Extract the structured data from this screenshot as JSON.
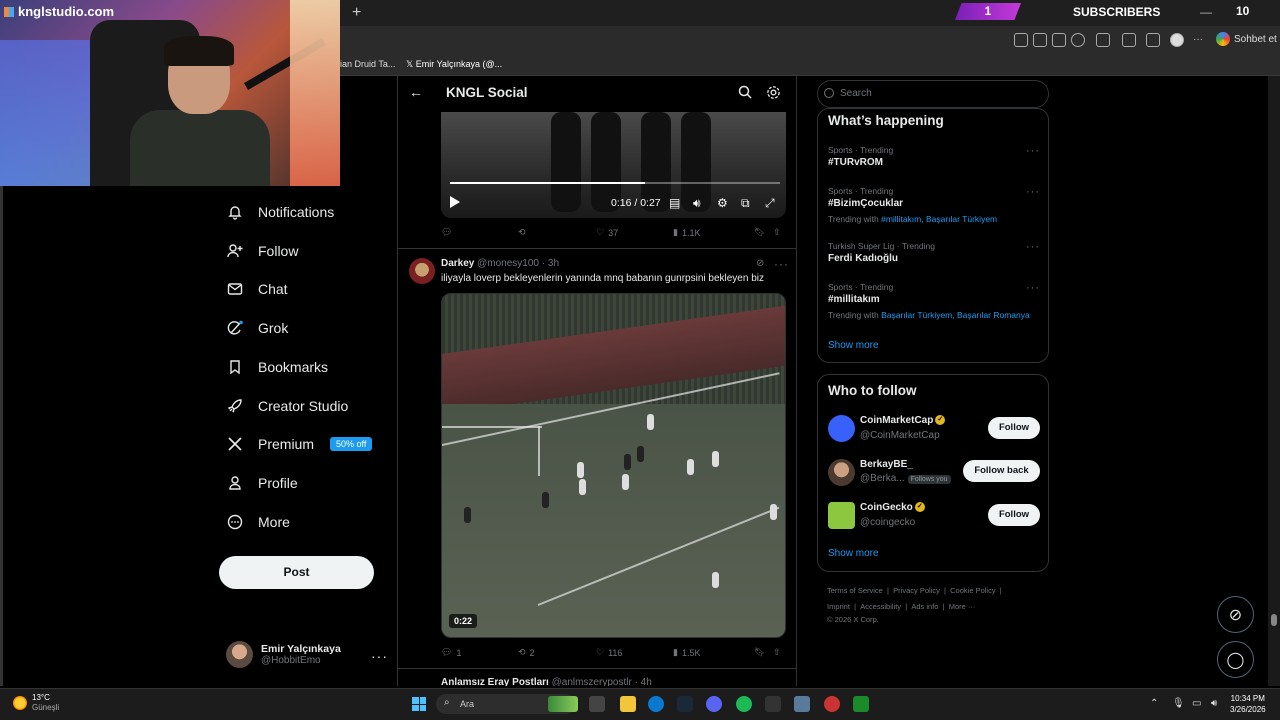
{
  "overlay": {
    "brand": "knglstudio.com",
    "subs_count": "1",
    "subs_label": "SUBSCRIBERS",
    "subs_value": "10"
  },
  "browser": {
    "new_tab": "+",
    "bookmarks": [
      "ian Druid Ta...",
      "Emir Yalçınkaya (@..."
    ],
    "profile_label": "Sohbet et"
  },
  "nav": {
    "items": [
      {
        "label": "Notifications",
        "icon": "bell-icon"
      },
      {
        "label": "Follow",
        "icon": "person-add-icon"
      },
      {
        "label": "Chat",
        "icon": "envelope-icon"
      },
      {
        "label": "Grok",
        "icon": "grok-icon"
      },
      {
        "label": "Bookmarks",
        "icon": "bookmark-icon"
      },
      {
        "label": "Creator Studio",
        "icon": "rocket-icon"
      },
      {
        "label": "Premium",
        "icon": "x-logo-icon"
      },
      {
        "label": "Profile",
        "icon": "person-icon"
      },
      {
        "label": "More",
        "icon": "more-circle-icon"
      }
    ],
    "premium_badge": "50% off",
    "post_label": "Post",
    "account": {
      "name": "Emir Yalçınkaya",
      "handle": "@HobbitEmo"
    }
  },
  "feed": {
    "title": "KNGL Social",
    "video1": {
      "time": "0:16 / 0:27",
      "progress": 0.59
    },
    "tweet1_actions": {
      "reply": "",
      "repost": "",
      "likes": "37",
      "views": "1.1K"
    },
    "tweet2": {
      "name": "Darkey",
      "handle": "@monesy100",
      "time": "· 3h",
      "text": "iliyayla loverp bekleyenlerin yanında mnq babanın gunrpsini bekleyen biz",
      "duration": "0:22",
      "replies": "1",
      "reposts": "2",
      "likes": "116",
      "views": "1.5K"
    },
    "tweet3": {
      "name": "Anlamsız Eray Postları",
      "handle": "@anlmszerypostlr",
      "time": "· 4h"
    }
  },
  "right": {
    "search_placeholder": "Search",
    "whats_happening": "What’s happening",
    "trends": [
      {
        "meta": "Sports · Trending",
        "name": "#TURvROM",
        "with": ""
      },
      {
        "meta": "Sports · Trending",
        "name": "#BizimÇocuklar",
        "with_label": "Trending with",
        "with": "#millitakım, Başarılar Türkiyem"
      },
      {
        "meta": "Turkish Super Lig · Trending",
        "name": "Ferdi Kadıoğlu",
        "with": ""
      },
      {
        "meta": "Sports · Trending",
        "name": "#millitakım",
        "with_label": "Trending with",
        "with": "Başarılar Türkiyem, Başarılar Romanya"
      }
    ],
    "show_more": "Show more",
    "who_to_follow": "Who to follow",
    "suggestions": [
      {
        "name": "CoinMarketCap",
        "handle": "@CoinMarketCap",
        "button": "Follow",
        "verified": true
      },
      {
        "name": "BerkayBE_",
        "handle": "@Berka...",
        "follows_you": "Follows you",
        "button": "Follow back"
      },
      {
        "name": "CoinGecko",
        "handle": "@coingecko",
        "button": "Follow",
        "verified": true
      }
    ],
    "footer": {
      "line1": [
        "Terms of Service",
        "|",
        "Privacy Policy",
        "|",
        "Cookie Policy",
        "|"
      ],
      "line2": [
        "Imprint",
        "|",
        "Accessibility",
        "|",
        "Ads info",
        "|",
        "More ···"
      ],
      "line3": "© 2026 X Corp."
    }
  },
  "taskbar": {
    "temp": "13°C",
    "condition": "Güneşli",
    "search": "Ara",
    "time": "10:34 PM",
    "date": "3/26/2026"
  },
  "colors": {
    "accent": "#1d9bf0",
    "background": "#000000",
    "border": "#2f3336"
  }
}
